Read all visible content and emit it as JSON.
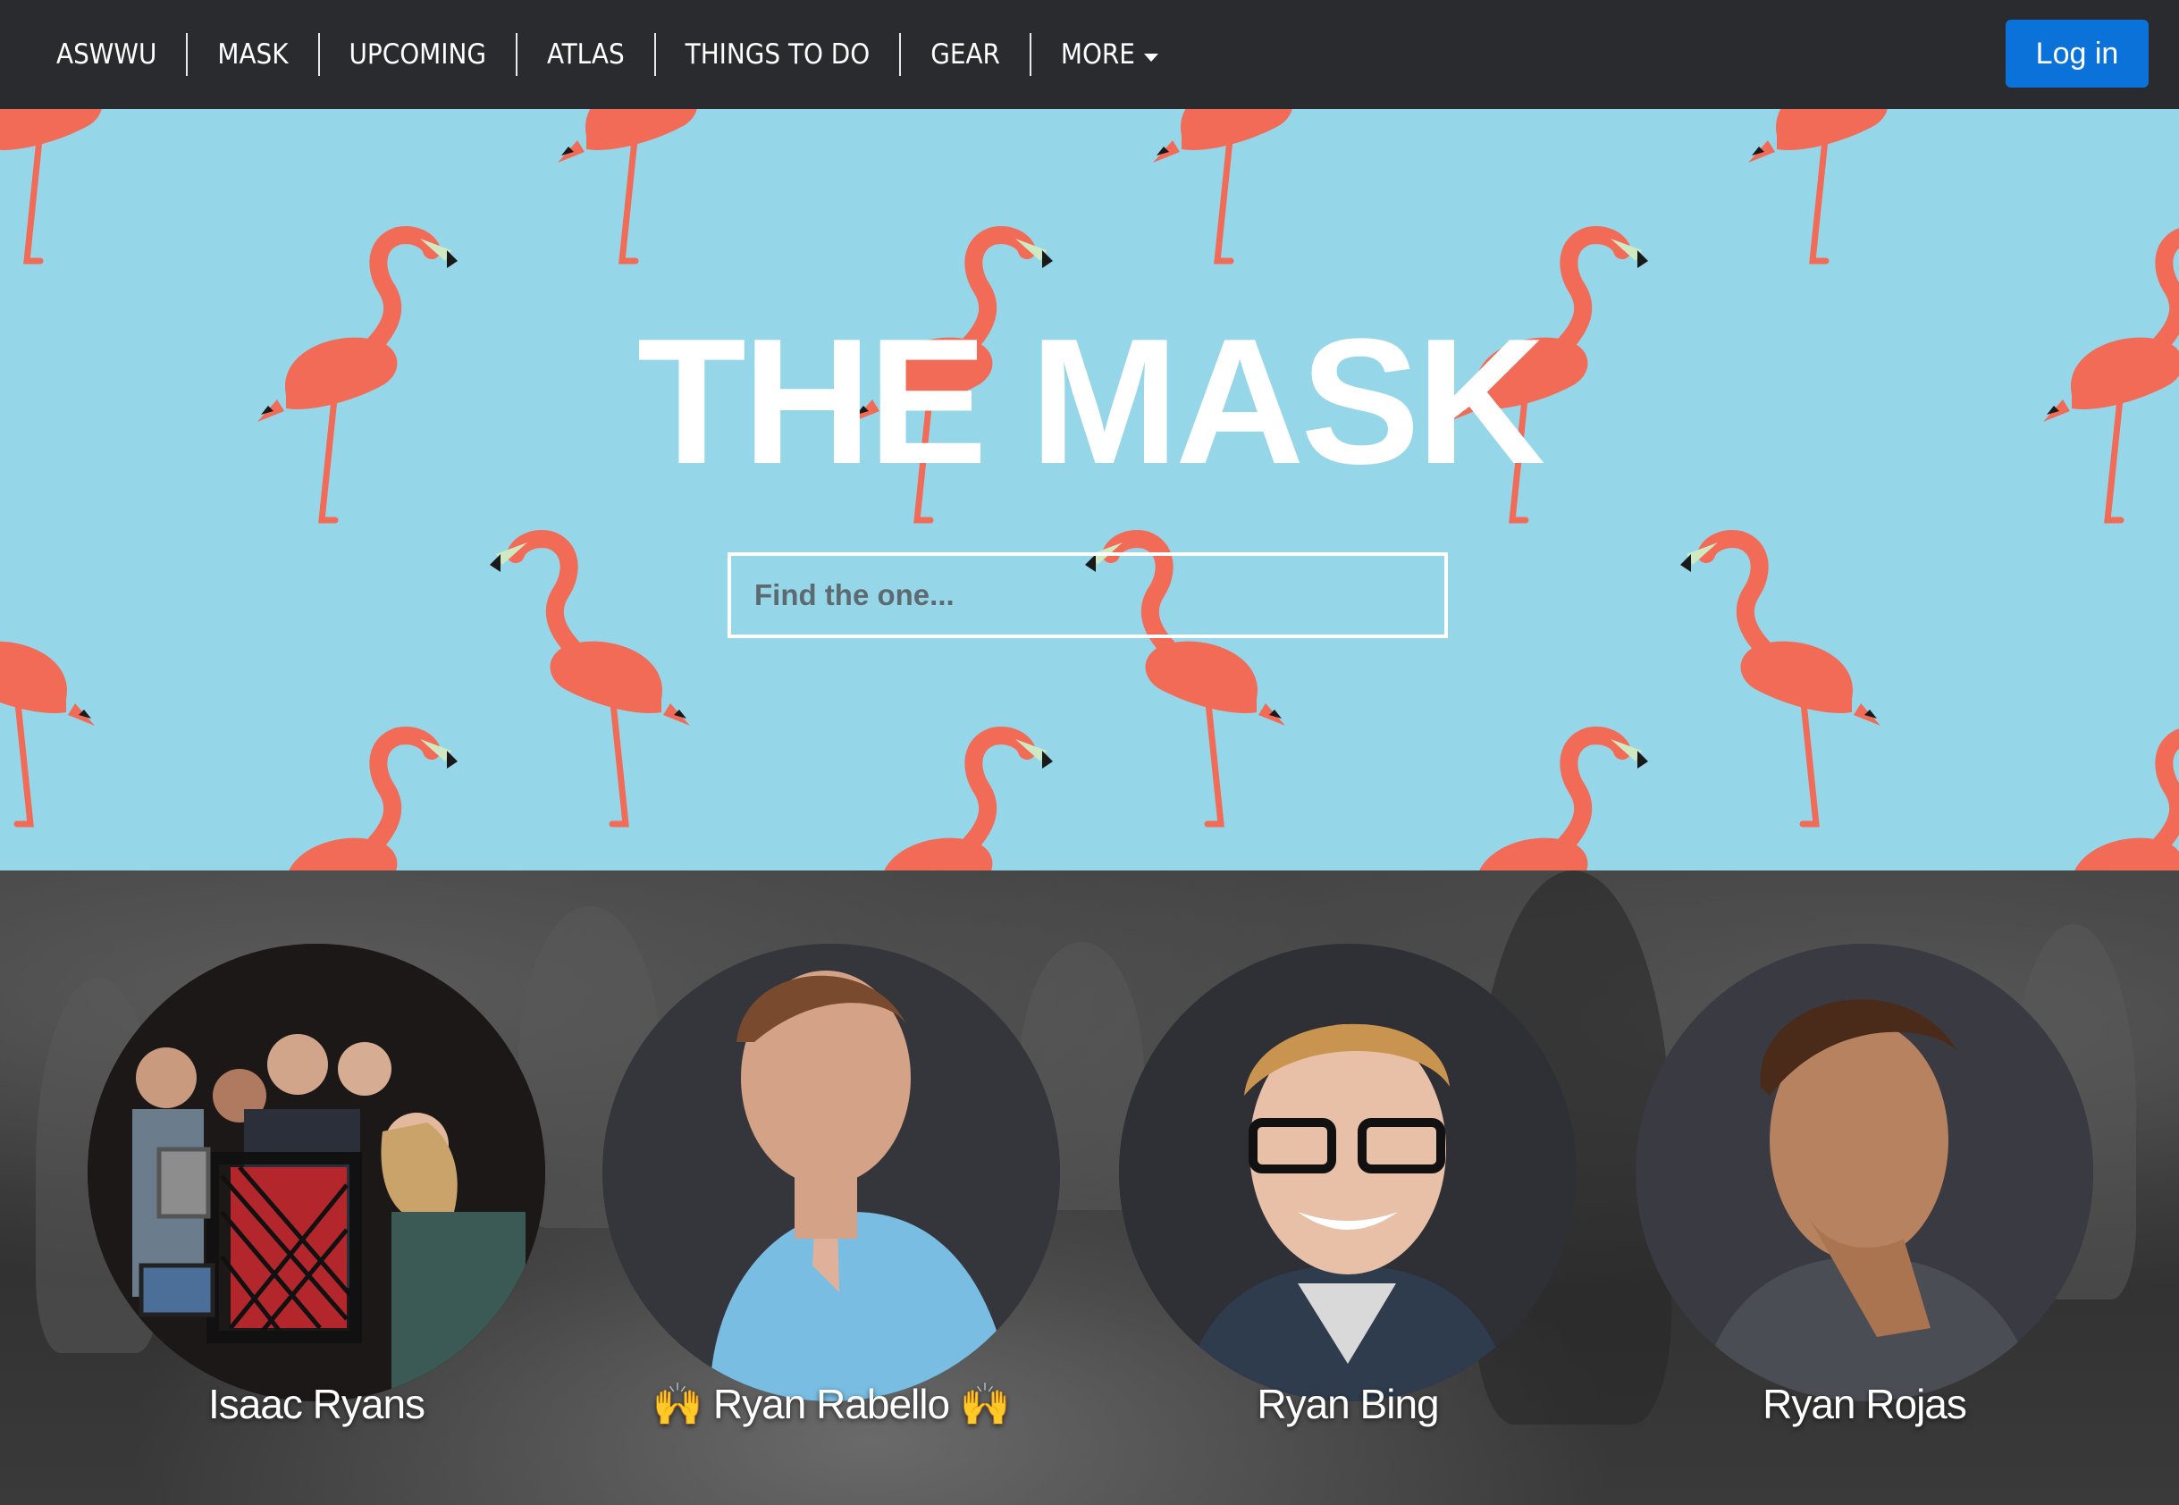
{
  "navbar": {
    "items": [
      {
        "label": "ASWWU"
      },
      {
        "label": "MASK"
      },
      {
        "label": "UPCOMING"
      },
      {
        "label": "ATLAS"
      },
      {
        "label": "THINGS TO DO"
      },
      {
        "label": "GEAR"
      },
      {
        "label": "MORE"
      }
    ],
    "login_label": "Log in"
  },
  "hero": {
    "title": "THE MASK",
    "search_placeholder": "Find the one..."
  },
  "people": [
    {
      "name": "Isaac Ryans"
    },
    {
      "name": "🙌 Ryan Rabello 🙌"
    },
    {
      "name": "Ryan Bing"
    },
    {
      "name": "Ryan Rojas"
    }
  ],
  "colors": {
    "navbar_bg": "#2a2b2e",
    "login_button": "#0b72d9",
    "hero_bg": "#96d6e9",
    "flamingo": "#f26b57"
  }
}
